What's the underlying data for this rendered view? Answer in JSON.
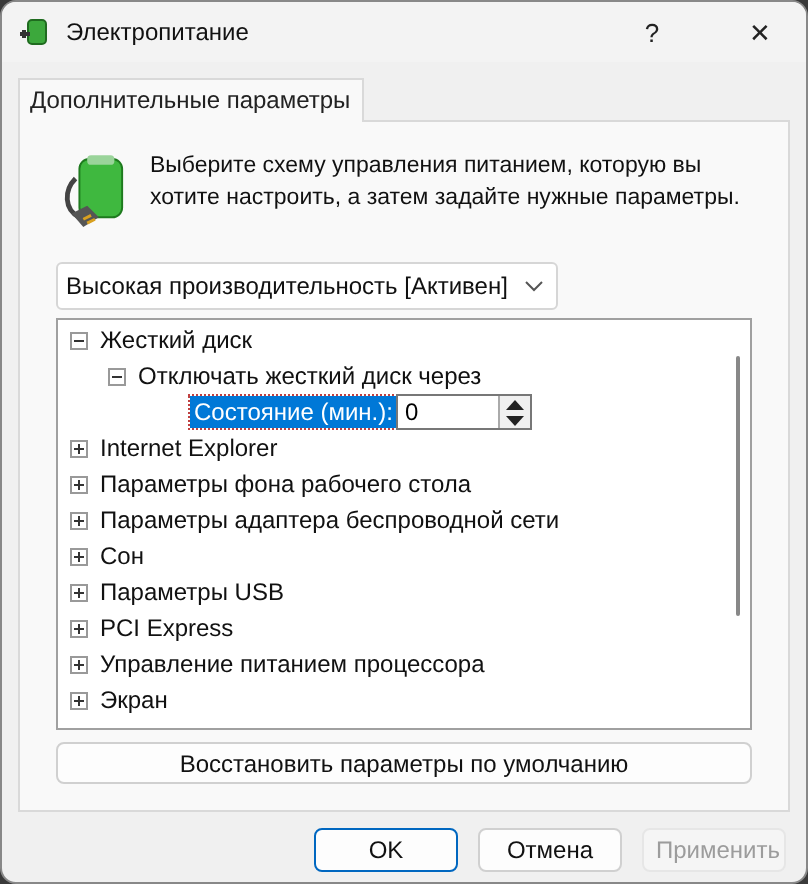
{
  "window": {
    "title": "Электропитание",
    "help": "?",
    "close": "✕"
  },
  "tabs": [
    {
      "label": "Дополнительные параметры",
      "selected": true
    }
  ],
  "intro": "Выберите схему управления питанием, которую вы хотите настроить, а затем задайте нужные параметры.",
  "plan_dropdown": {
    "value": "Высокая производительность [Активен]"
  },
  "tree": [
    {
      "label": "Жесткий диск",
      "expanded": true,
      "children": [
        {
          "label": "Отключать жесткий диск через",
          "expanded": true,
          "children": [
            {
              "kind": "setting",
              "label": "Состояние (мин.):",
              "value": "0",
              "selected": true
            }
          ]
        }
      ]
    },
    {
      "label": "Internet Explorer",
      "expanded": false
    },
    {
      "label": "Параметры фона рабочего стола",
      "expanded": false
    },
    {
      "label": "Параметры адаптера беспроводной сети",
      "expanded": false
    },
    {
      "label": "Сон",
      "expanded": false
    },
    {
      "label": "Параметры USB",
      "expanded": false
    },
    {
      "label": "PCI Express",
      "expanded": false
    },
    {
      "label": "Управление питанием процессора",
      "expanded": false
    },
    {
      "label": "Экран",
      "expanded": false
    }
  ],
  "restore_button": "Восстановить параметры по умолчанию",
  "buttons": [
    {
      "label": "OK",
      "disabled": false,
      "default": true
    },
    {
      "label": "Отмена",
      "disabled": false,
      "default": false
    },
    {
      "label": "Применить",
      "disabled": true,
      "default": false
    }
  ]
}
